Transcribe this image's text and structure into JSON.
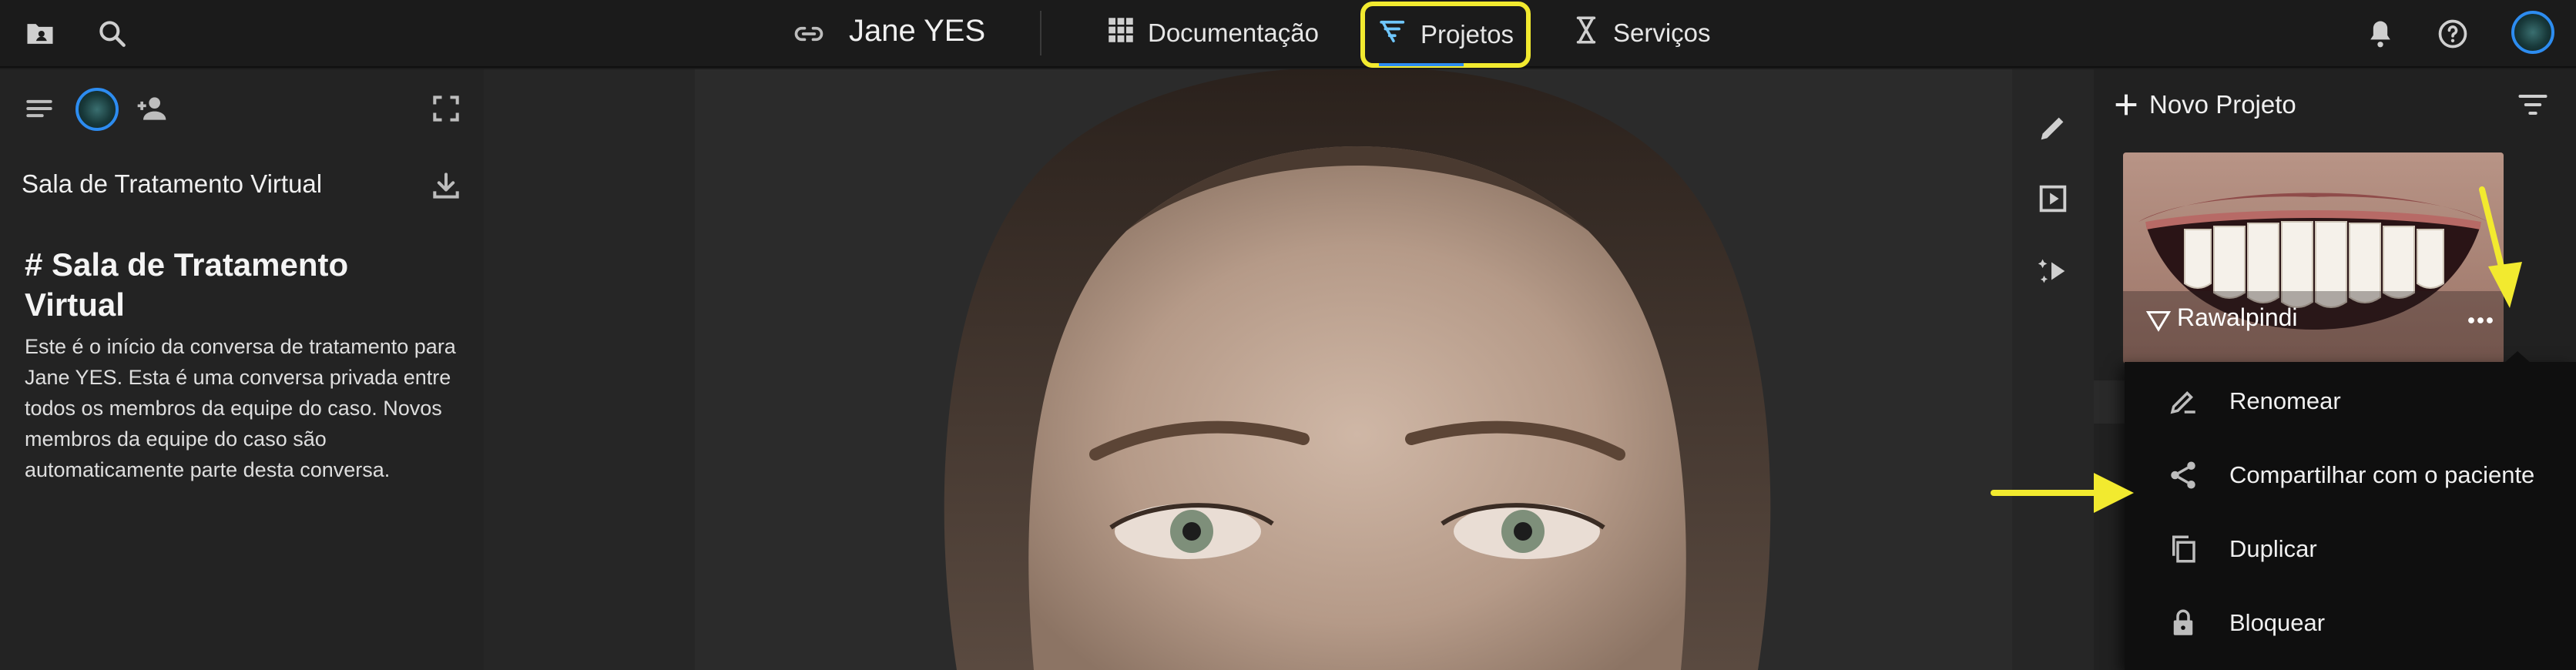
{
  "header": {
    "case_title": "Jane YES",
    "nav": [
      {
        "label": "Documentação",
        "icon": "grid-icon"
      },
      {
        "label": "Projetos",
        "icon": "projects-filter-icon",
        "active": true
      },
      {
        "label": "Serviços",
        "icon": "hourglass-icon"
      }
    ],
    "left_icons": [
      "folder-person-icon",
      "search-icon"
    ],
    "right_icons": [
      "bell-icon",
      "help-icon",
      "avatar"
    ],
    "colors": {
      "highlight": "#f2ea2f",
      "accent": "#2d8cf0"
    }
  },
  "left_panel": {
    "toolbar_icons": [
      "menu-icon",
      "avatar",
      "add-person-icon",
      "fullscreen-icon"
    ],
    "room_title": "Sala de Tratamento Virtual",
    "heading": "# Sala de Tratamento Virtual",
    "description": "Este é o início da conversa de tratamento para Jane YES. Esta é uma conversa privada entre todos os membros da equipe do caso. Novos membros da equipe do caso são automaticamente parte desta conversa."
  },
  "tools": [
    "pencil-icon",
    "play-box-icon",
    "sparkle-play-icon"
  ],
  "right_panel": {
    "new_project_label": "Novo Projeto",
    "project": {
      "name": "Rawalpindi"
    },
    "context_menu": [
      {
        "label": "Renomear",
        "icon": "rename-pencil-icon"
      },
      {
        "label": "Compartilhar com o paciente",
        "icon": "share-icon"
      },
      {
        "label": "Duplicar",
        "icon": "copy-icon"
      },
      {
        "label": "Bloquear",
        "icon": "lock-icon"
      }
    ]
  }
}
